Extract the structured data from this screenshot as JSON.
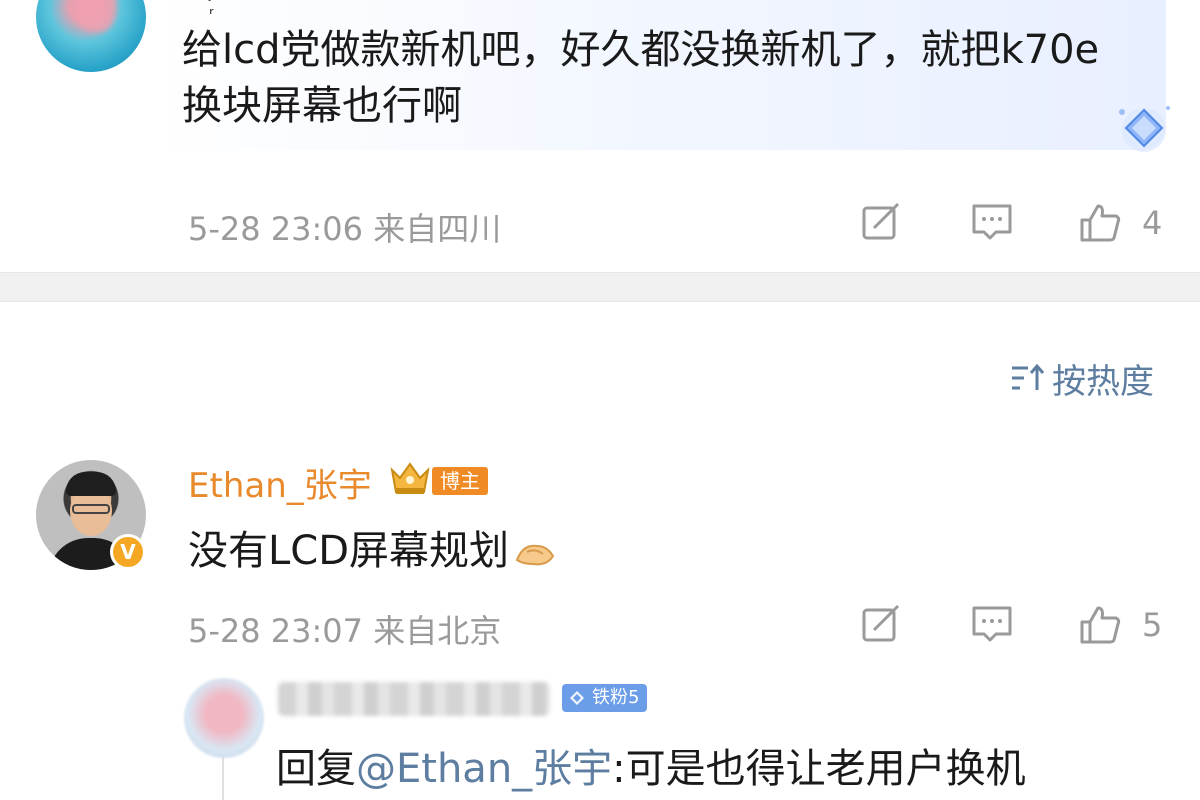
{
  "top_post": {
    "username_fragment": "ᴵ ᴵᴵ᷊ ᴵ",
    "text": "给lcd党做款新机吧，好久都没换新机了，就把k70e换块屏幕也行啊",
    "time": "5-28 23:06  来自四川",
    "like_count": "4"
  },
  "sort": {
    "label": "按热度",
    "icon": "sort-icon"
  },
  "comment": {
    "author": "Ethan_张宇",
    "role_badge": "博主",
    "verified_mark": "V",
    "text": "没有LCD屏幕规划",
    "time": "5-28 23:07  来自北京",
    "like_count": "5"
  },
  "reply": {
    "fan_badge": "铁粉5",
    "prefix": "回复",
    "mention": "@Ethan_张宇",
    "text": ":可是也得让老用户换机"
  },
  "colors": {
    "accent_blue": "#5d7ea0",
    "author_orange": "#e8892c",
    "badge_orange": "#f08a24",
    "fan_blue": "#6b9de8",
    "meta_gray": "#9a9a9a",
    "separator": "#f0f0f0"
  },
  "icons": [
    "edit-icon",
    "comment-icon",
    "like-icon",
    "sort-icon",
    "crown-icon",
    "diamond-badge-icon",
    "verified-icon",
    "gem-icon"
  ]
}
